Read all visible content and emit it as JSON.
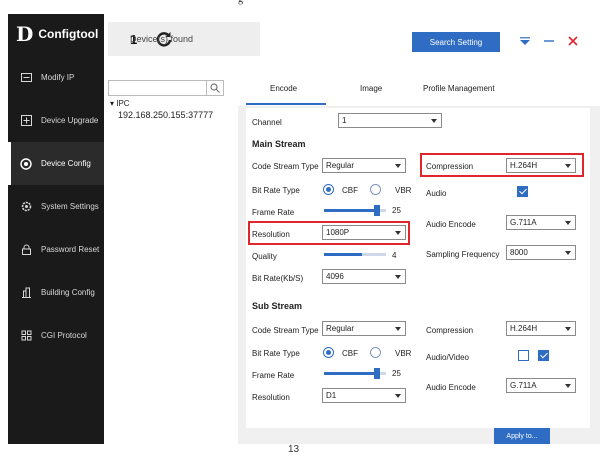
{
  "page_top_fragment": "g",
  "app": {
    "logo_mark": "D",
    "name": "Configtool"
  },
  "sidebar": {
    "items": [
      {
        "label": "Modify IP",
        "icon": "monitor-icon"
      },
      {
        "label": "Device Upgrade",
        "icon": "upgrade-icon"
      },
      {
        "label": "Device Config",
        "icon": "target-icon",
        "active": true
      },
      {
        "label": "System Settings",
        "icon": "gear-icon"
      },
      {
        "label": "Password Reset",
        "icon": "lock-icon"
      },
      {
        "label": "Building Config",
        "icon": "building-icon"
      },
      {
        "label": "CGI Protocol",
        "icon": "grid-icon"
      }
    ]
  },
  "header": {
    "device_count": "1",
    "device_count_label": "Device(s) found",
    "search_button": "Search Setting"
  },
  "tree": {
    "search_placeholder": "",
    "node_type": "▾ IPC",
    "node_ip": "192.168.250.155:37777"
  },
  "tabs": [
    {
      "label": "Encode",
      "active": true
    },
    {
      "label": "Image"
    },
    {
      "label": "Profile Management"
    }
  ],
  "encode": {
    "channel_label": "Channel",
    "channel_value": "1",
    "main_stream": {
      "title": "Main Stream",
      "code_stream_type_label": "Code Stream Type",
      "code_stream_type_value": "Regular",
      "bit_rate_type_label": "Bit Rate Type",
      "cbr_label": "CBF",
      "vbr_label": "VBR",
      "frame_rate_label": "Frame Rate",
      "frame_rate_value": "25",
      "frame_rate_fill": 0.85,
      "resolution_label": "Resolution",
      "resolution_value": "1080P",
      "quality_label": "Quality",
      "quality_value": "4",
      "quality_fill": 0.62,
      "bit_rate_label": "Bit Rate(Kb/S)",
      "bit_rate_value": "4096",
      "compression_label": "Compression",
      "compression_value": "H.264H",
      "audio_label": "Audio",
      "audio_encode_label": "Audio Encode",
      "audio_encode_value": "G.711A",
      "sampling_label": "Sampling Frequency",
      "sampling_value": "8000"
    },
    "sub_stream": {
      "title": "Sub Stream",
      "code_stream_type_label": "Code Stream Type",
      "code_stream_type_value": "Regular",
      "bit_rate_type_label": "Bit Rate Type",
      "cbr_label": "CBF",
      "vbr_label": "VBR",
      "frame_rate_label": "Frame Rate",
      "frame_rate_value": "25",
      "frame_rate_fill": 0.85,
      "resolution_label": "Resolution",
      "resolution_value": "D1",
      "compression_label": "Compression",
      "compression_value": "H.264H",
      "audio_video_label": "Audio/Video",
      "audio_encode_label": "Audio Encode",
      "audio_encode_value": "G.711A"
    }
  },
  "apply_button": "Apply to...",
  "footer_page_number": "13",
  "colors": {
    "accent": "#2f6cc4",
    "highlight": "#e0262c",
    "sidebar": "#1a1a1a"
  }
}
